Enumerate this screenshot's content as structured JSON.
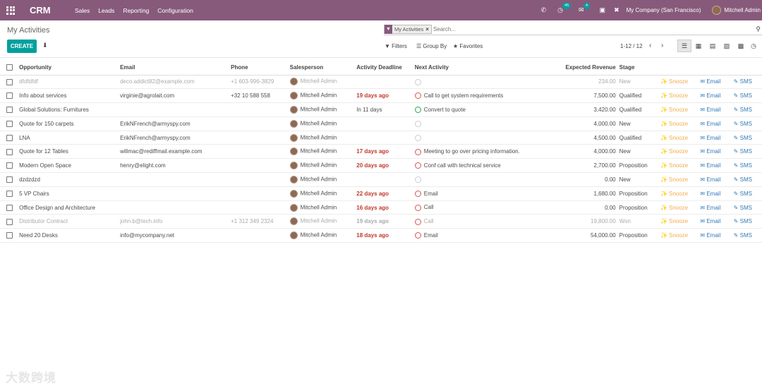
{
  "navbar": {
    "app_name": "CRM",
    "menu": [
      "Sales",
      "Leads",
      "Reporting",
      "Configuration"
    ],
    "activity_count": "45",
    "message_count": "4",
    "company": "My Company (San Francisco)",
    "user": "Mitchell Admin"
  },
  "control_panel": {
    "breadcrumb": "My Activities",
    "facet_label": "My Activities",
    "search_placeholder": "Search...",
    "create_label": "CREATE",
    "filters_label": "Filters",
    "groupby_label": "Group By",
    "favorites_label": "Favorites",
    "pager": "1-12 / 12"
  },
  "table": {
    "columns": [
      "Opportunity",
      "Email",
      "Phone",
      "Salesperson",
      "Activity Deadline",
      "Next Activity",
      "Expected Revenue",
      "Stage"
    ],
    "action_labels": {
      "snooze": "Snooze",
      "email": "Email",
      "sms": "SMS"
    },
    "rows": [
      {
        "opportunity": "dfdfdfdf",
        "email": "deco.addict82@example.com",
        "phone": "+1 603-996-3829",
        "salesperson": "Mitchell Admin",
        "deadline": "",
        "deadline_state": "none",
        "next_activity": "",
        "activity_state": "none",
        "revenue": "234.00",
        "stage": "New",
        "muted": true
      },
      {
        "opportunity": "Info about services",
        "email": "virginie@agrolait.com",
        "phone": "+32 10 588 558",
        "salesperson": "Mitchell Admin",
        "deadline": "19 days ago",
        "deadline_state": "late",
        "next_activity": "Call to get system requirements",
        "activity_state": "late",
        "revenue": "7,500.00",
        "stage": "Qualified",
        "muted": false
      },
      {
        "opportunity": "Global Solutions: Furnitures",
        "email": "",
        "phone": "",
        "salesperson": "Mitchell Admin",
        "deadline": "In 11 days",
        "deadline_state": "ok",
        "next_activity": "Convert to quote",
        "activity_state": "ok",
        "revenue": "3,420.00",
        "stage": "Qualified",
        "muted": false
      },
      {
        "opportunity": "Quote for 150 carpets",
        "email": "ErikNFrench@armyspy.com",
        "phone": "",
        "salesperson": "Mitchell Admin",
        "deadline": "",
        "deadline_state": "none",
        "next_activity": "",
        "activity_state": "none",
        "revenue": "4,000.00",
        "stage": "New",
        "muted": false
      },
      {
        "opportunity": "LNA",
        "email": "ErikNFrench@armyspy.com",
        "phone": "",
        "salesperson": "Mitchell Admin",
        "deadline": "",
        "deadline_state": "none",
        "next_activity": "",
        "activity_state": "none",
        "revenue": "4,500.00",
        "stage": "Qualified",
        "muted": false
      },
      {
        "opportunity": "Quote for 12 Tables",
        "email": "willmac@rediffmail.example.com",
        "phone": "",
        "salesperson": "Mitchell Admin",
        "deadline": "17 days ago",
        "deadline_state": "late",
        "next_activity": "Meeting to go over pricing information.",
        "activity_state": "late",
        "revenue": "4,000.00",
        "stage": "New",
        "muted": false
      },
      {
        "opportunity": "Modern Open Space",
        "email": "henry@elight.com",
        "phone": "",
        "salesperson": "Mitchell Admin",
        "deadline": "20 days ago",
        "deadline_state": "late",
        "next_activity": "Conf call with technical service",
        "activity_state": "late",
        "revenue": "2,700.00",
        "stage": "Proposition",
        "muted": false
      },
      {
        "opportunity": "dzdzdzd",
        "email": "",
        "phone": "",
        "salesperson": "Mitchell Admin",
        "deadline": "",
        "deadline_state": "none",
        "next_activity": "",
        "activity_state": "none",
        "revenue": "0.00",
        "stage": "New",
        "muted": false
      },
      {
        "opportunity": "5 VP Chairs",
        "email": "",
        "phone": "",
        "salesperson": "Mitchell Admin",
        "deadline": "22 days ago",
        "deadline_state": "late",
        "next_activity": "Email",
        "activity_state": "late",
        "revenue": "1,680.00",
        "stage": "Proposition",
        "muted": false
      },
      {
        "opportunity": "Office Design and Architecture",
        "email": "",
        "phone": "",
        "salesperson": "Mitchell Admin",
        "deadline": "16 days ago",
        "deadline_state": "late",
        "next_activity": "Call",
        "activity_state": "late",
        "revenue": "0.00",
        "stage": "Proposition",
        "muted": false
      },
      {
        "opportunity": "Distributor Contract",
        "email": "john.b@tech.info",
        "phone": "+1 312 349 2324",
        "salesperson": "Mitchell Admin",
        "deadline": "19 days ago",
        "deadline_state": "late",
        "next_activity": "Call",
        "activity_state": "late",
        "revenue": "19,800.00",
        "stage": "Won",
        "muted": true
      },
      {
        "opportunity": "Need 20 Desks",
        "email": "info@mycompany.net",
        "phone": "",
        "salesperson": "Mitchell Admin",
        "deadline": "18 days ago",
        "deadline_state": "late",
        "next_activity": "Email",
        "activity_state": "late",
        "revenue": "54,000.00",
        "stage": "Proposition",
        "muted": false
      }
    ]
  },
  "watermark": "大数跨境",
  "colors": {
    "brand": "#875a7b",
    "accent": "#00a09d",
    "late": "#c0392b",
    "snooze": "#f0ad4e",
    "link": "#337ab7"
  },
  "icons": [
    "apps-grid-icon",
    "phone-icon",
    "activity-clock-icon",
    "chat-icon",
    "gift-icon",
    "tools-icon",
    "filter-icon",
    "close-icon",
    "search-icon",
    "download-icon",
    "star-icon",
    "chevron-left-icon",
    "chevron-right-icon",
    "list-view-icon",
    "kanban-view-icon",
    "graph-view-icon",
    "pivot-view-icon",
    "calendar-view-icon",
    "activity-view-icon",
    "snooze-icon",
    "envelope-icon",
    "sms-icon"
  ]
}
